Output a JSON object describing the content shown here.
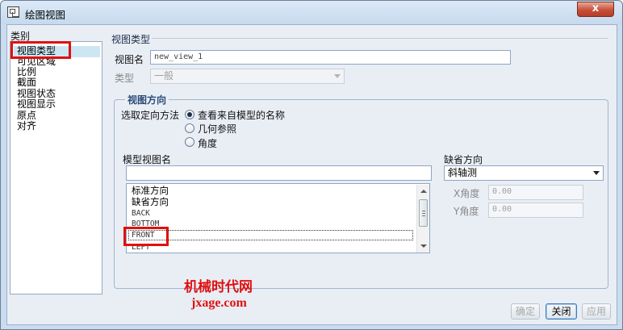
{
  "window": {
    "title": "绘图视图",
    "close_glyph": "x"
  },
  "categories": {
    "label": "类别",
    "items": [
      "视图类型",
      "可见区域",
      "比例",
      "截面",
      "视图状态",
      "视图显示",
      "原点",
      "对齐"
    ],
    "selected": "视图类型"
  },
  "view_type": {
    "section_title": "视图类型",
    "view_name_label": "视图名",
    "view_name_value": "new_view_1",
    "type_label": "类型",
    "type_value": "一般"
  },
  "view_orientation": {
    "legend": "视图方向",
    "method_label": "选取定向方法",
    "options": [
      "查看来自模型的名称",
      "几何参照",
      "角度"
    ],
    "selected_option": "查看来自模型的名称",
    "model_view_name_label": "模型视图名",
    "model_view_name_value": "",
    "list_items": [
      "标准方向",
      "缺省方向",
      "BACK",
      "BOTTOM",
      "FRONT",
      "LEFT"
    ],
    "focused_item": "FRONT",
    "default_orientation_label": "缺省方向",
    "default_orientation_value": "斜轴测",
    "x_angle_label": "X角度",
    "x_angle_value": "0.00",
    "y_angle_label": "Y角度",
    "y_angle_value": "0.00"
  },
  "watermark": {
    "line1": "机械时代网",
    "line2": "jxage.com"
  },
  "buttons": {
    "ok": "确定",
    "close": "关闭",
    "apply": "应用"
  },
  "colors": {
    "annotation_red": "#e01010",
    "selection": "#cde6f3",
    "close_button": "#c7503a"
  }
}
